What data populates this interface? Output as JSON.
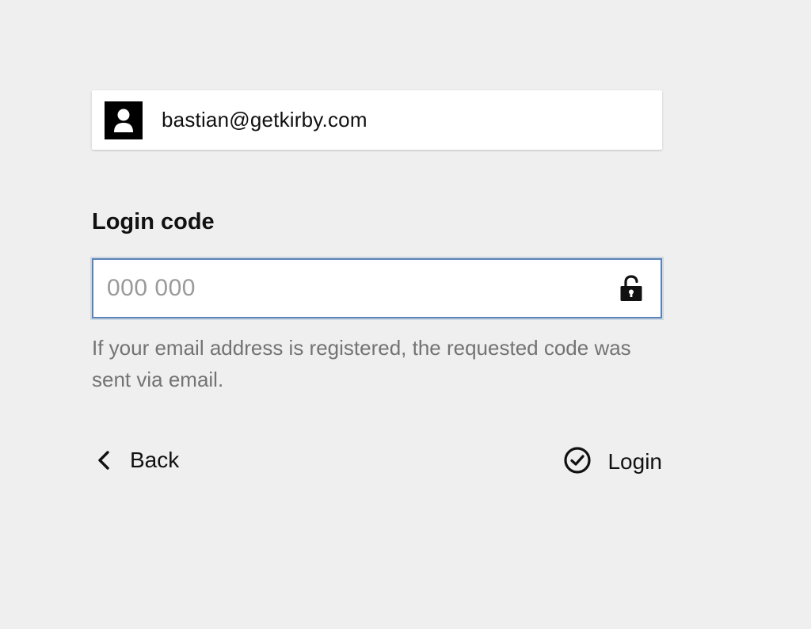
{
  "user": {
    "email": "bastian@getkirby.com",
    "avatar_icon": "user-icon"
  },
  "form": {
    "label": "Login code",
    "placeholder": "000 000",
    "value": "",
    "field_icon": "unlock-icon",
    "help": "If your email address is registered, the requested code was sent via email."
  },
  "actions": {
    "back_label": "Back",
    "back_icon": "chevron-left-icon",
    "login_label": "Login",
    "login_icon": "check-circle-icon"
  },
  "colors": {
    "background": "#efefef",
    "focus_border": "#5a84b8",
    "help_text": "#737373",
    "placeholder": "#9a9a9a"
  }
}
